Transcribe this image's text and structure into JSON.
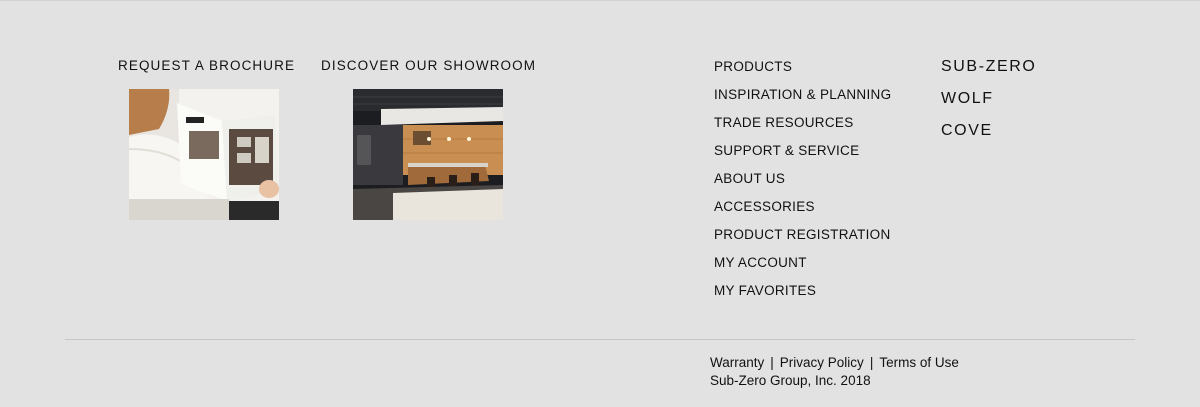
{
  "promos": {
    "brochure": {
      "title": "REQUEST A BROCHURE",
      "image_alt": "person reading a brochure"
    },
    "showroom": {
      "title": "DISCOVER OUR SHOWROOM",
      "image_alt": "kitchen showroom"
    }
  },
  "nav": {
    "items": [
      {
        "label": "PRODUCTS"
      },
      {
        "label": "INSPIRATION & PLANNING"
      },
      {
        "label": "TRADE RESOURCES"
      },
      {
        "label": "SUPPORT & SERVICE"
      },
      {
        "label": "ABOUT US"
      },
      {
        "label": "ACCESSORIES"
      },
      {
        "label": "PRODUCT REGISTRATION"
      },
      {
        "label": "MY ACCOUNT"
      },
      {
        "label": "MY FAVORITES"
      }
    ]
  },
  "brands": {
    "items": [
      {
        "label": "SUB-ZERO"
      },
      {
        "label": "WOLF"
      },
      {
        "label": "COVE"
      }
    ]
  },
  "legal": {
    "warranty": "Warranty",
    "privacy": "Privacy Policy",
    "terms": "Terms of Use",
    "separator": "|",
    "copyright": "Sub-Zero Group, Inc. 2018"
  },
  "colors": {
    "background": "#e2e2e2",
    "text": "#111111",
    "divider": "#c6c6c6"
  }
}
